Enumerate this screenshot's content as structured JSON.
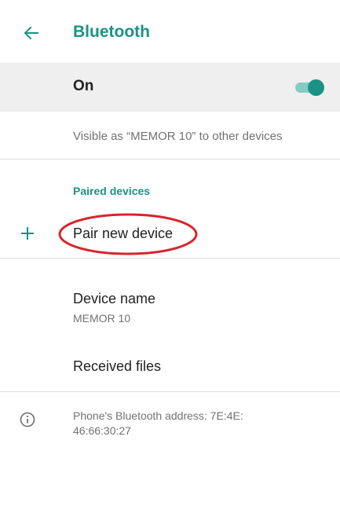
{
  "appbar": {
    "title": "Bluetooth",
    "back_icon": "arrow-back-icon"
  },
  "toggle_row": {
    "label": "On",
    "state": "on",
    "accent_color": "#1a9384"
  },
  "visibility": {
    "text": "Visible as “MEMOR 10” to other devices"
  },
  "paired_section": {
    "header": "Paired devices"
  },
  "pair_new": {
    "icon": "plus-icon",
    "label": "Pair new device",
    "annotation_color": "#d8242e"
  },
  "device_name": {
    "title": "Device name",
    "value": "MEMOR 10"
  },
  "received_files": {
    "label": "Received files"
  },
  "bluetooth_address": {
    "icon": "info-icon",
    "line1": "Phone's Bluetooth address: 7E:4E:",
    "line2": "46:66:30:27"
  }
}
